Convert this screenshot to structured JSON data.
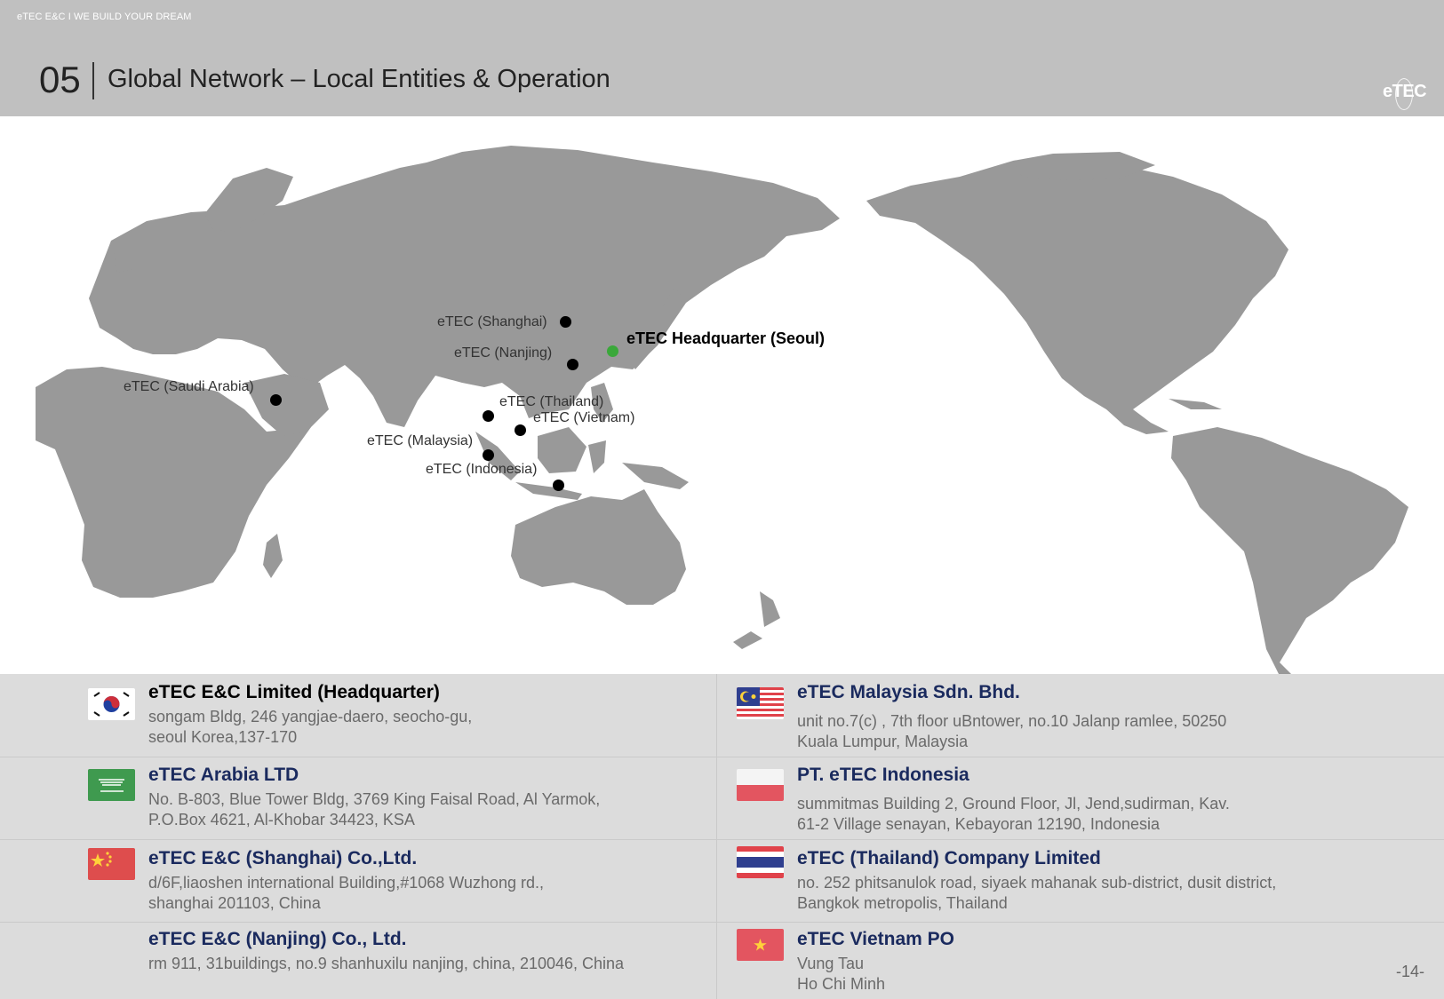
{
  "header": {
    "tagline": "eTEC E&C  I  WE BUILD YOUR DREAM",
    "section_number": "05",
    "title": "Global Network – Local Entities & Operation",
    "logo": "eTEC"
  },
  "map": {
    "markers": {
      "hq": "eTEC Headquarter (Seoul)",
      "shanghai": "eTEC (Shanghai)",
      "nanjing": "eTEC (Nanjing)",
      "saudi": "eTEC (Saudi Arabia)",
      "thailand": "eTEC (Thailand)",
      "vietnam": "eTEC (Vietnam)",
      "malaysia": "eTEC (Malaysia)",
      "indonesia": "eTEC (Indonesia)"
    },
    "land_color": "#999999",
    "hq_color": "#3aa83a"
  },
  "entities": {
    "hq": {
      "name": "eTEC E&C Limited (Headquarter)",
      "addr1": "songam Bldg, 246 yangjae-daero, seocho-gu,",
      "addr2": "seoul Korea,137-170",
      "flag": "korea-flag"
    },
    "arabia": {
      "name": "eTEC Arabia LTD",
      "addr1": "No. B-803, Blue Tower Bldg, 3769 King Faisal Road, Al Yarmok,",
      "addr2": "P.O.Box 4621, Al-Khobar 34423, KSA",
      "flag": "saudi-flag"
    },
    "shanghai": {
      "name": "eTEC E&C (Shanghai) Co.,Ltd.",
      "addr1": "d/6F,liaoshen international Building,#1068  Wuzhong rd.,",
      "addr2": "shanghai 201103, China",
      "flag": "china-flag"
    },
    "nanjing": {
      "name": "eTEC E&C (Nanjing) Co., Ltd.",
      "addr1": "rm 911, 31buildings, no.9 shanhuxilu nanjing, china, 210046, China"
    },
    "malaysia": {
      "name": "eTEC Malaysia Sdn. Bhd.",
      "addr1": "unit no.7(c) , 7th floor uBntower, no.10 Jalanp ramlee, 50250",
      "addr2": "Kuala Lumpur, Malaysia",
      "flag": "malaysia-flag"
    },
    "indonesia": {
      "name": "PT. eTEC Indonesia",
      "addr1": "summitmas Building 2, Ground Floor, Jl, Jend,sudirman,  Kav.",
      "addr2": "61-2 Village senayan, Kebayoran 12190, Indonesia",
      "flag": "indonesia-flag"
    },
    "thailand": {
      "name": "eTEC (Thailand) Company Limited",
      "addr1": "no. 252 phitsanulok road, siyaek mahanak sub-district, dusit district,",
      "addr2": "Bangkok metropolis, Thailand",
      "flag": "thailand-flag"
    },
    "vietnam": {
      "name": "eTEC Vietnam PO",
      "addr1": "Vung Tau",
      "addr2": "Ho Chi Minh",
      "flag": "vietnam-flag"
    }
  },
  "footer": {
    "page": "-14-"
  }
}
